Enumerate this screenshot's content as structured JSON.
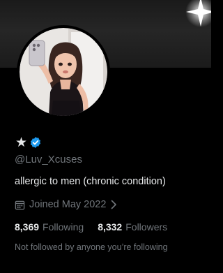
{
  "profile": {
    "name_emoji": "★",
    "verified": true,
    "handle": "@Luv_Xcuses",
    "bio": "allergic to men (chronic condition)",
    "joined": "Joined May 2022",
    "following_count": "8,369",
    "following_label": "Following",
    "followers_count": "8,332",
    "followers_label": "Followers",
    "followed_by_note": "Not followed by anyone you’re following"
  },
  "icons": {
    "verified": "verified-badge-icon",
    "calendar": "calendar-icon",
    "chevron": "chevron-right-icon",
    "sparkle": "sparkle-icon"
  },
  "colors": {
    "background": "#000000",
    "primary_text": "#e7e9ea",
    "secondary_text": "#71767b",
    "verified_blue": "#1d9bf0"
  }
}
